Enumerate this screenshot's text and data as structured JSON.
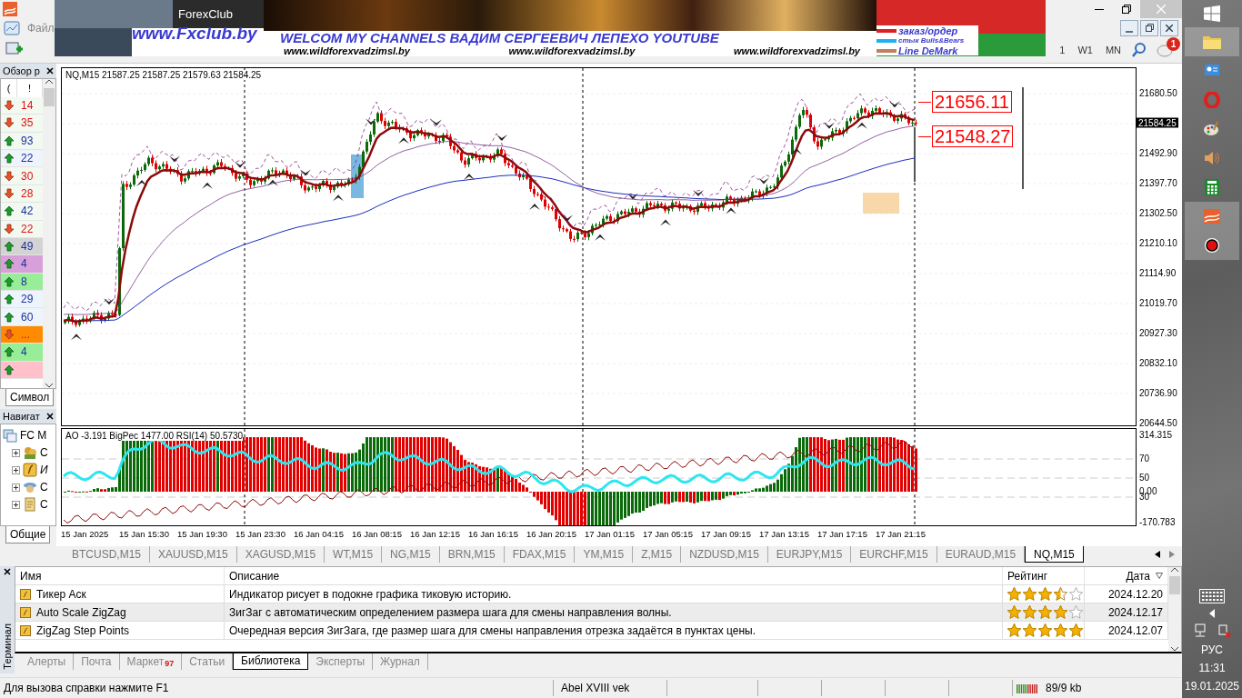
{
  "banner": {
    "brand": "ForexClub",
    "site": "www.Fxclub.by",
    "headline": "WELCOM MY CHANNELS ВАДИМ СЕРГЕЕВИЧ ЛЕПЕХО YOUTUBE",
    "links": [
      "www.wildforexvadzimsl.by",
      "www.wildforexvadzimsl.by",
      "www.wildforexvadzimsl.by"
    ],
    "legend": [
      {
        "label": "заказ/ордер",
        "color": "#e02020"
      },
      {
        "label": "стык Bulls&Bears",
        "color": "#20b0f0"
      },
      {
        "label": "Line DeMark",
        "color": "#c08060"
      }
    ]
  },
  "menu": [
    "Файл"
  ],
  "toolbar": {
    "timeframes": [
      "1",
      "W1",
      "MN"
    ],
    "notifications": "1"
  },
  "market_watch": {
    "title": "Обзор р",
    "columns": [
      "(",
      "!"
    ],
    "rows": [
      {
        "up": false,
        "value": "14",
        "color": "#f2f9f0"
      },
      {
        "up": false,
        "value": "35",
        "color": "#f2f9f0"
      },
      {
        "up": true,
        "value": "93",
        "color": "#f2f9f0"
      },
      {
        "up": true,
        "value": "22",
        "color": "#eef4fb"
      },
      {
        "up": false,
        "value": "30",
        "color": "#f2f9f0"
      },
      {
        "up": false,
        "value": "28",
        "color": "#f2f9f0"
      },
      {
        "up": true,
        "value": "42",
        "color": "#f2f9f0"
      },
      {
        "up": false,
        "value": "22",
        "color": "#f2f9f0"
      },
      {
        "up": true,
        "value": "49",
        "color": "#d3d3d3"
      },
      {
        "up": true,
        "value": "4",
        "color": "#d8a0d8"
      },
      {
        "up": true,
        "value": "8",
        "color": "#98ee98"
      },
      {
        "up": true,
        "value": "29",
        "color": "#eef4fb"
      },
      {
        "up": true,
        "value": "60",
        "color": "#eef4fb"
      },
      {
        "up": false,
        "value": "...",
        "color": "#ff8c00"
      },
      {
        "up": true,
        "value": "4",
        "color": "#98ee98"
      },
      {
        "up": true,
        "color": "#ffc0cb"
      }
    ],
    "tab": "Символ"
  },
  "navigator": {
    "title": "Навигат",
    "tree": [
      {
        "label": "FC M",
        "children": [
          {
            "label": "С",
            "kind": "accounts",
            "expanded": false
          },
          {
            "label": "И",
            "kind": "indicators",
            "expanded": false
          },
          {
            "label": "С",
            "kind": "experts",
            "expanded": false
          },
          {
            "label": "С",
            "kind": "scripts",
            "expanded": false
          }
        ]
      }
    ],
    "tab": "Общие"
  },
  "chart": {
    "header": "NQ,M15  21587.25 21587.25 21579.63 21584.25",
    "price_labels": [
      "21680.50",
      "21492.90",
      "21397.70",
      "21302.50",
      "21210.10",
      "21114.90",
      "21019.70",
      "20927.30",
      "20832.10",
      "20736.90",
      "20644.50"
    ],
    "current_price": "21584.25",
    "levels": [
      "21656.11",
      "21548.27"
    ],
    "indicator_header": "AO -3.191  BigPec 1477.00  RSI(14) 50.5730",
    "indicator_labels": [
      "314.315",
      "70",
      "50",
      "0.00",
      "30",
      "-170.783"
    ],
    "time_labels": [
      "15 Jan 2025",
      "15 Jan 15:30",
      "15 Jan 19:30",
      "15 Jan 23:30",
      "16 Jan 04:15",
      "16 Jan 08:15",
      "16 Jan 12:15",
      "16 Jan 16:15",
      "16 Jan 20:15",
      "17 Jan 01:15",
      "17 Jan 05:15",
      "17 Jan 09:15",
      "17 Jan 13:15",
      "17 Jan 17:15",
      "17 Jan 21:15"
    ]
  },
  "chart_tabs": [
    {
      "label": "BTCUSD,M15",
      "selected": false
    },
    {
      "label": "XAUUSD,M15",
      "selected": false
    },
    {
      "label": "XAGUSD,M15",
      "selected": false
    },
    {
      "label": "WT,M15",
      "selected": false
    },
    {
      "label": "NG,M15",
      "selected": false
    },
    {
      "label": "BRN,M15",
      "selected": false
    },
    {
      "label": "FDAX,M15",
      "selected": false
    },
    {
      "label": "YM,M15",
      "selected": false
    },
    {
      "label": "Z,M15",
      "selected": false
    },
    {
      "label": "NZDUSD,M15",
      "selected": false
    },
    {
      "label": "EURJPY,M15",
      "selected": false
    },
    {
      "label": "EURCHF,M15",
      "selected": false
    },
    {
      "label": "EURAUD,M15",
      "selected": false
    },
    {
      "label": "NQ,M15",
      "selected": true
    }
  ],
  "terminal": {
    "title": "Терминал",
    "columns": [
      "Имя",
      "Описание",
      "Рейтинг",
      "Дата"
    ],
    "rows": [
      {
        "name": "Тикер Аск",
        "description": "Индикатор рисует в подокне графика тиковую историю.",
        "stars": 3.5,
        "date": "2024.12.20"
      },
      {
        "name": "Auto Scale ZigZag",
        "description": "ЗигЗаг с автоматическим определением размера шага для смены направления волны.",
        "stars": 4,
        "date": "2024.12.17"
      },
      {
        "name": "ZigZag Step Points",
        "description": "Очередная версия ЗигЗага, где размер шага для смены направления отрезка задаётся в пунктах цены.",
        "stars": 5,
        "date": "2024.12.07"
      }
    ],
    "tabs": [
      {
        "label": "Алерты",
        "selected": false
      },
      {
        "label": "Почта",
        "selected": false
      },
      {
        "label": "Маркет",
        "badge": "97",
        "selected": false
      },
      {
        "label": "Статьи",
        "selected": false
      },
      {
        "label": "Библиотека",
        "selected": true
      },
      {
        "label": "Эксперты",
        "selected": false
      },
      {
        "label": "Журнал",
        "selected": false
      }
    ]
  },
  "status_bar": {
    "help": "Для вызова справки нажмите F1",
    "profile": "Abel XVIII vek",
    "traffic": "89/9 kb"
  },
  "taskbar": {
    "language": "РУС",
    "time": "11:31",
    "date": "19.01.2025"
  }
}
